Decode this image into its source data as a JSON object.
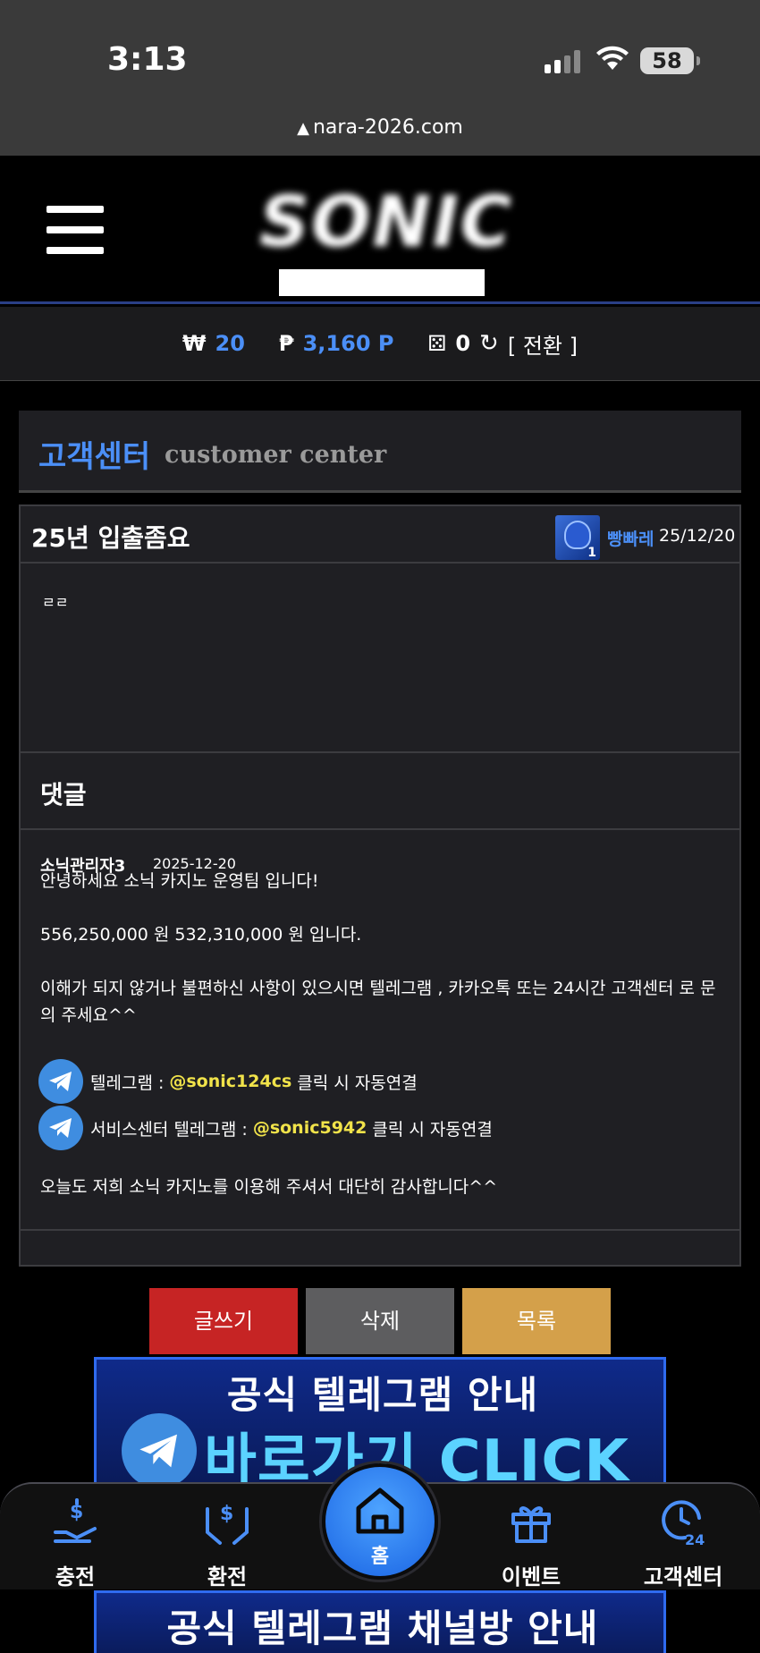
{
  "status_bar": {
    "time": "3:13",
    "battery": "58",
    "url": "nara-2026.com"
  },
  "header": {
    "logo_text": "SONIC"
  },
  "balance": {
    "won_symbol": "₩",
    "won_value": "20",
    "point_symbol": "₱",
    "point_value": "3,160 P",
    "dice_value": "0",
    "convert_label": "[ 전환 ]"
  },
  "page": {
    "title_ko": "고객센터",
    "title_en": "customer center"
  },
  "post": {
    "title": "25년 입출좀요",
    "avatar_level": "1",
    "author": "빵빠레",
    "date": "25/12/20",
    "body": "ㄹㄹ"
  },
  "comments": {
    "header": "댓글",
    "items": [
      {
        "author": "소닉관리자3",
        "date": "2025-12-20",
        "line1": "안녕하세요 소닉 카지노 운영팀 입니다!",
        "line2": "556,250,000 원 532,310,000 원 입니다.",
        "line3": "이해가 되지 않거나 불편하신 사항이 있으시면 텔레그램 , 카카오톡 또는 24시간 고객센터 로 문의 주세요^^",
        "tg1_prefix": "텔레그램 :",
        "tg1_handle": "@sonic124cs",
        "tg1_suffix": "클릭 시 자동연결",
        "tg2_prefix": "서비스센터 텔레그램 :",
        "tg2_handle": "@sonic5942",
        "tg2_suffix": "클릭 시 자동연결",
        "closing": "오늘도 저희 소닉 카지노를 이용해 주셔서 대단히 감사합니다^^"
      }
    ]
  },
  "buttons": {
    "write": "글쓰기",
    "delete": "삭제",
    "list": "목록"
  },
  "banners": {
    "telegram_title": "공식 텔레그램 안내",
    "telegram_click": "바로가기 CLICK",
    "channel_title": "공식 텔레그램 채널방 안내"
  },
  "bottom_nav": {
    "charge": "충전",
    "exchange": "환전",
    "home": "홈",
    "event": "이벤트",
    "support": "고객센터"
  },
  "colors": {
    "accent": "#4b8ff7",
    "write_btn": "#c62424",
    "delete_btn": "#5d5d5f",
    "list_btn": "#d4a04a",
    "handle": "#f1e34a"
  }
}
